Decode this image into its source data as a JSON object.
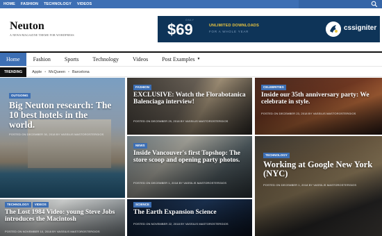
{
  "topbar": {
    "links": [
      "HOME",
      "FASHION",
      "TECHNOLOGY",
      "VIDEOS"
    ]
  },
  "header": {
    "logo": "Neuton",
    "tagline": "A NEWS/MAGAZINE THEME FOR WORDPRESS"
  },
  "banner": {
    "price_label": "ONLY",
    "price": "$69",
    "headline": "UNLIMITED DOWNLOADS",
    "subline": "FOR A WHOLE YEAR",
    "brand": "cssigniter"
  },
  "mainnav": {
    "items": [
      "Home",
      "Fashion",
      "Sports",
      "Technology",
      "Videos",
      "Post Examples"
    ]
  },
  "trending": {
    "label": "TRENDING",
    "links": [
      "Apple",
      "McQueen",
      "Barcelona"
    ]
  },
  "tiles": [
    {
      "badges": [
        "OUTGOING"
      ],
      "title": "Big Neuton research: The 10 best hotels in the world.",
      "meta": "POSTED ON DECEMBER 30, 2018 BY VASSILIS MASTOROSTERGIOS"
    },
    {
      "badges": [
        "FASHION"
      ],
      "title": "EXCLUSIVE: Watch the Florabotanica Balenciaga interview!",
      "meta": "POSTED ON DECEMBER 29, 2018 BY VASSILIS MASTOROSTERGIOS"
    },
    {
      "badges": [
        "CELEBRITIES"
      ],
      "title": "Inside our 35th anniversary party: We celebrate in style.",
      "meta": "POSTED ON DECEMBER 23, 2018 BY VASSILIS MASTOROSTERGIOS"
    },
    {
      "badges": [
        "NEWS"
      ],
      "title": "Inside Vancouver's first Topshop: The store scoop and opening party photos.",
      "meta": "POSTED ON DECEMBER 1, 2018 BY VASSILIS MASTOROSTERGIOS"
    },
    {
      "badges": [
        "TECHNOLOGY"
      ],
      "title": "Working at Google New York (NYC)",
      "meta": "POSTED ON DECEMBER 1, 2018 BY VASSILIS MASTOROSTERGIOS"
    },
    {
      "badges": [
        "TECHNOLOGY",
        "VIDEOS"
      ],
      "title": "The Lost 1984 Video: young Steve Jobs introduces the Macintosh",
      "meta": "POSTED ON NOVEMBER 10, 2018 BY VASSILIS MASTOROSTERGIOS"
    },
    {
      "badges": [
        "SCIENCE"
      ],
      "title": "The Earth Expansion Science",
      "meta": "POSTED ON NOVEMBER 22, 2018 BY VASSILIS MASTOROSTERGIOS"
    }
  ],
  "colors": {
    "accent": "#3d6fb4",
    "banner_bg": "#0e3458",
    "banner_highlight": "#e9c43f"
  }
}
